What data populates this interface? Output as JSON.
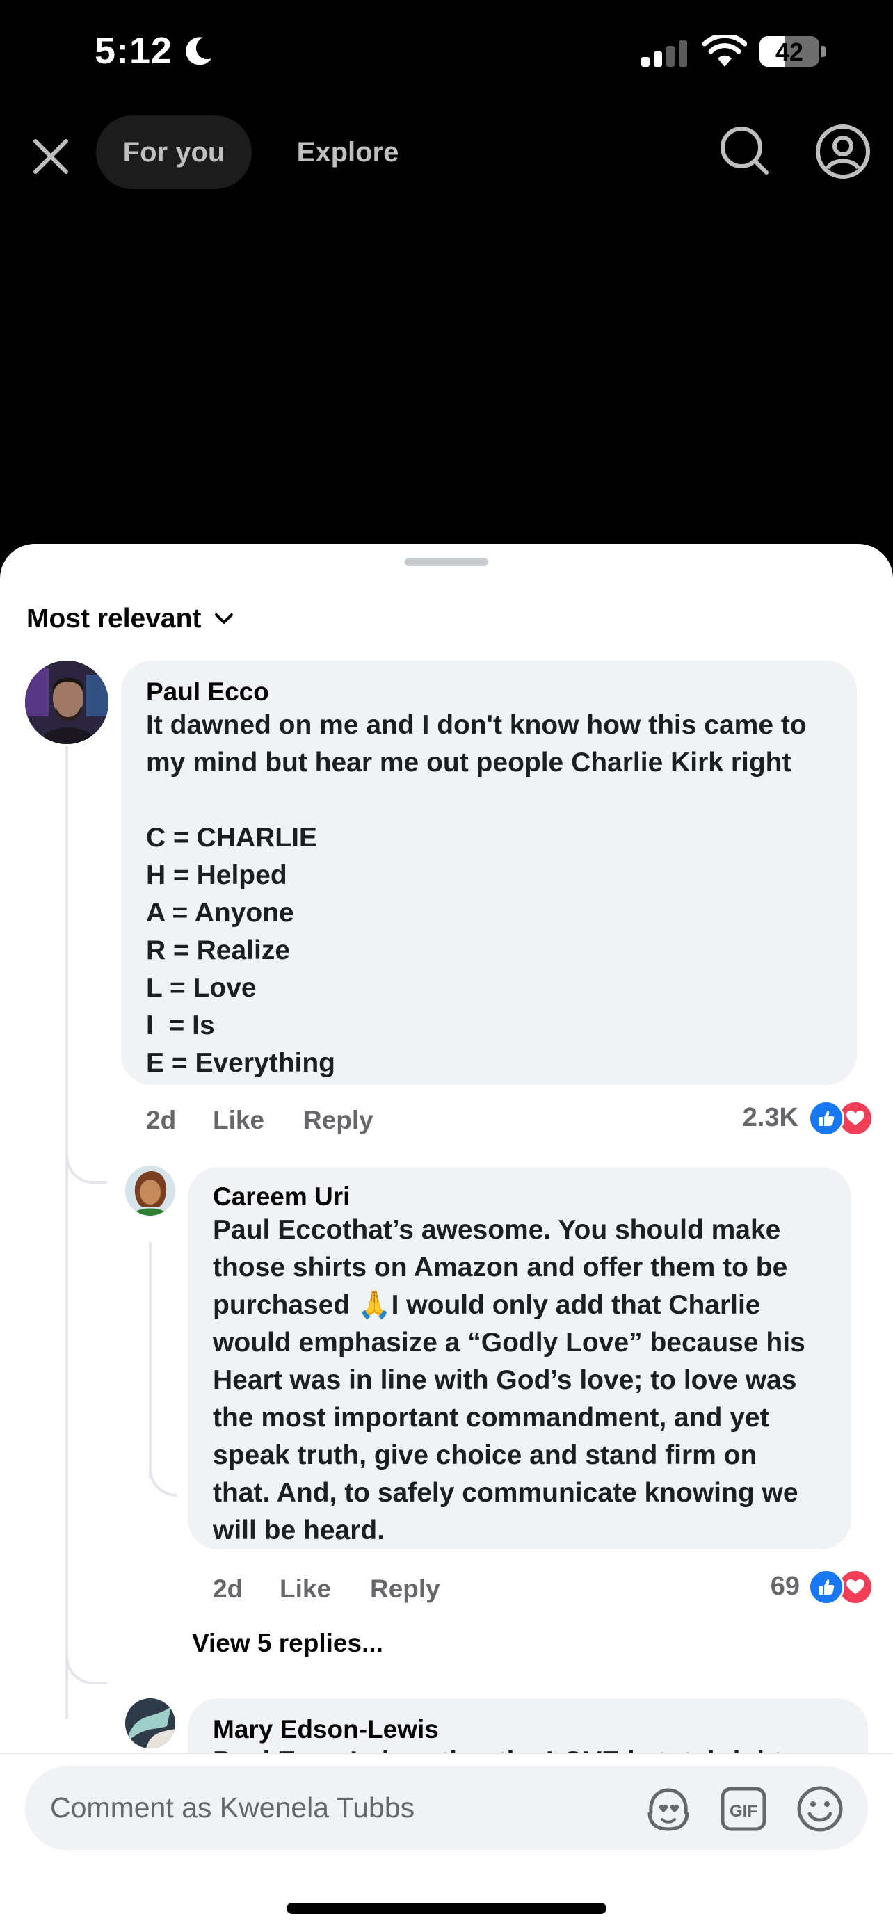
{
  "status_bar": {
    "time": "5:12",
    "battery_percent": 42,
    "battery_label": "42"
  },
  "top_nav": {
    "tabs": [
      {
        "label": "For you",
        "active": true
      },
      {
        "label": "Explore",
        "active": false
      }
    ],
    "icons": [
      "close-icon",
      "search-icon",
      "profile-icon"
    ]
  },
  "sheet": {
    "sort_label": "Most relevant"
  },
  "comments": [
    {
      "author": "Paul Ecco",
      "text": "It dawned on me and I don't know how this came to\nmy mind but hear me out people Charlie Kirk right\n\nC = CHARLIE\nH = Helped\nA = Anyone\nR = Realize\nL = Love\nI  = Is\nE = Everything",
      "age": "2d",
      "like_label": "Like",
      "reply_label": "Reply",
      "reaction_count": "2.3K",
      "reactions": [
        "like",
        "love"
      ]
    },
    {
      "author": "Careem Uri",
      "text_before_emoji": "Paul Eccothat’s awesome. You should make\nthose shirts on Amazon and offer them to be\npurchased ",
      "emoji": "🙏",
      "text_after_emoji": "I would only add that Charlie\nwould emphasize a “Godly Love” because his\nHeart was in line with God’s love; to love was\nthe most important commandment, and yet\nspeak truth, give choice and stand firm on\nthat. And, to safely communicate knowing we\nwill be heard.",
      "age": "2d",
      "like_label": "Like",
      "reply_label": "Reply",
      "reaction_count": "69",
      "reactions": [
        "like",
        "love"
      ],
      "view_replies_label": "View 5 replies..."
    },
    {
      "author": "Mary Edson-Lewis",
      "text_partial": "Paul Ecco Laborating the LOVE is total right... we are to love"
    }
  ],
  "composer": {
    "placeholder": "Comment as Kwenela Tubbs",
    "icons": [
      "avatar-sticker-icon",
      "gif-icon",
      "emoji-icon"
    ]
  },
  "colors": {
    "like_blue": "#1877f2",
    "love_red": "#f33e58",
    "bubble_gray": "#f0f2f5",
    "meta_gray": "#65676b"
  }
}
